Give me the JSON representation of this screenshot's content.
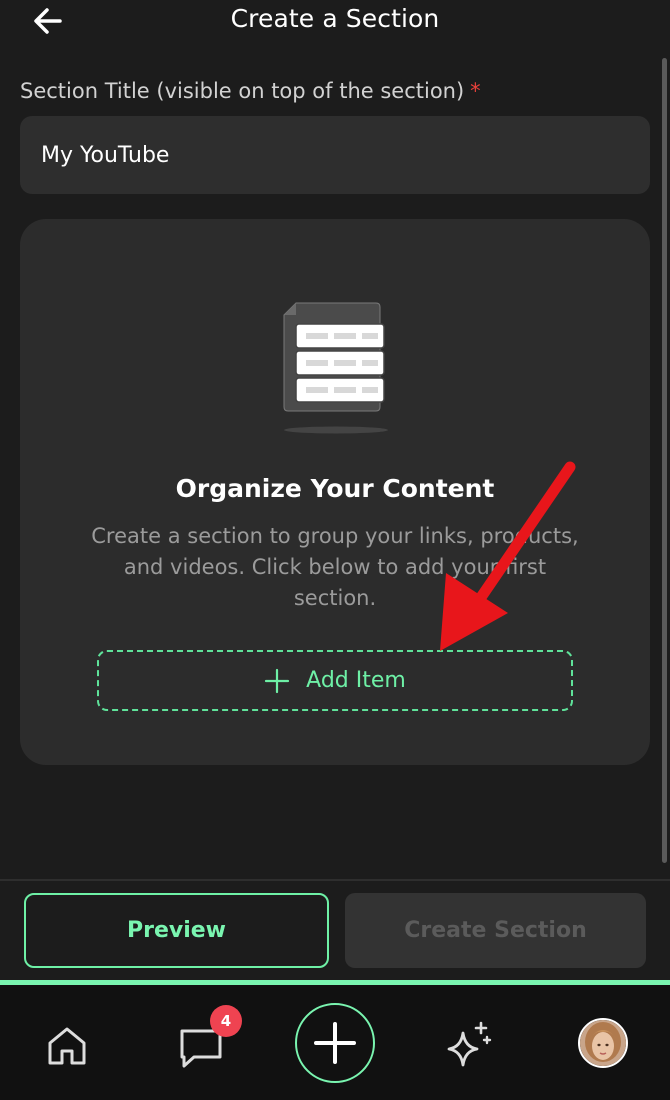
{
  "header": {
    "title": "Create a Section",
    "back_icon": "arrow-left-icon"
  },
  "form": {
    "title_label": "Section Title (visible on top of the section)",
    "required_marker": "*",
    "title_value": "My YouTube"
  },
  "empty_state": {
    "illustration": "stacked-document-icon",
    "heading": "Organize Your Content",
    "description": "Create a section to group your links, products, and videos. Click below to add your first section.",
    "add_item_label": "Add Item",
    "add_icon": "plus-icon"
  },
  "footer": {
    "preview_label": "Preview",
    "create_label": "Create Section"
  },
  "bottom_nav": {
    "items": [
      {
        "name": "home",
        "icon": "home-icon"
      },
      {
        "name": "messages",
        "icon": "chat-bubble-icon",
        "badge": "4"
      },
      {
        "name": "create",
        "icon": "plus-icon"
      },
      {
        "name": "ai",
        "icon": "sparkles-icon"
      },
      {
        "name": "profile",
        "icon": "avatar"
      }
    ]
  },
  "colors": {
    "background": "#1c1c1c",
    "surface": "#2c2c2c",
    "accent": "#7af5b0",
    "required": "#e8403a",
    "badge": "#ef4351",
    "annotation_arrow": "#e8161b"
  }
}
